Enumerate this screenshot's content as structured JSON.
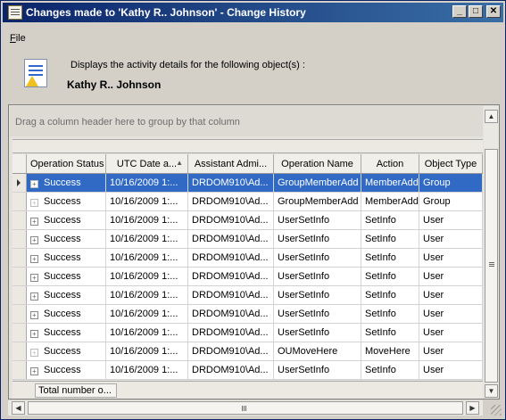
{
  "window": {
    "title": "Changes made to 'Kathy R.. Johnson' - Change History",
    "minimize_glyph": "_",
    "maximize_glyph": "□",
    "close_glyph": "✕"
  },
  "menu": {
    "items": [
      {
        "label": "File",
        "accel": "F",
        "rest": "ile"
      }
    ]
  },
  "info": {
    "description": "Displays the activity details for the following object(s) :",
    "object_name": "Kathy R.. Johnson"
  },
  "grid": {
    "group_hint": "Drag a column header here to group by that column",
    "columns": [
      {
        "label": "Operation Status",
        "width": 89
      },
      {
        "label": "UTC Date a...",
        "width": 92,
        "sorted": true
      },
      {
        "label": "Assistant Admi...",
        "width": 96
      },
      {
        "label": "Operation Name",
        "width": 98
      },
      {
        "label": "Action",
        "width": 65
      },
      {
        "label": "Object Type",
        "width": 71
      }
    ],
    "sort_glyph": "▲",
    "rows": [
      {
        "status": "Success",
        "date": "10/16/2009 1:...",
        "admin": "DRDOM910\\Ad...",
        "operation": "GroupMemberAdd",
        "action": "MemberAdd",
        "type": "Group",
        "selected": true,
        "expander_dim": true
      },
      {
        "status": "Success",
        "date": "10/16/2009 1:...",
        "admin": "DRDOM910\\Ad...",
        "operation": "GroupMemberAdd",
        "action": "MemberAdd",
        "type": "Group",
        "expander_dim": true
      },
      {
        "status": "Success",
        "date": "10/16/2009 1:...",
        "admin": "DRDOM910\\Ad...",
        "operation": "UserSetInfo",
        "action": "SetInfo",
        "type": "User"
      },
      {
        "status": "Success",
        "date": "10/16/2009 1:...",
        "admin": "DRDOM910\\Ad...",
        "operation": "UserSetInfo",
        "action": "SetInfo",
        "type": "User"
      },
      {
        "status": "Success",
        "date": "10/16/2009 1:...",
        "admin": "DRDOM910\\Ad...",
        "operation": "UserSetInfo",
        "action": "SetInfo",
        "type": "User"
      },
      {
        "status": "Success",
        "date": "10/16/2009 1:...",
        "admin": "DRDOM910\\Ad...",
        "operation": "UserSetInfo",
        "action": "SetInfo",
        "type": "User"
      },
      {
        "status": "Success",
        "date": "10/16/2009 1:...",
        "admin": "DRDOM910\\Ad...",
        "operation": "UserSetInfo",
        "action": "SetInfo",
        "type": "User"
      },
      {
        "status": "Success",
        "date": "10/16/2009 1:...",
        "admin": "DRDOM910\\Ad...",
        "operation": "UserSetInfo",
        "action": "SetInfo",
        "type": "User"
      },
      {
        "status": "Success",
        "date": "10/16/2009 1:...",
        "admin": "DRDOM910\\Ad...",
        "operation": "UserSetInfo",
        "action": "SetInfo",
        "type": "User"
      },
      {
        "status": "Success",
        "date": "10/16/2009 1:...",
        "admin": "DRDOM910\\Ad...",
        "operation": "OUMoveHere",
        "action": "MoveHere",
        "type": "User",
        "expander_dim": true
      },
      {
        "status": "Success",
        "date": "10/16/2009 1:...",
        "admin": "DRDOM910\\Ad...",
        "operation": "UserSetInfo",
        "action": "SetInfo",
        "type": "User"
      }
    ],
    "footer": "Total number o...",
    "selection_color": "#316ac5"
  }
}
